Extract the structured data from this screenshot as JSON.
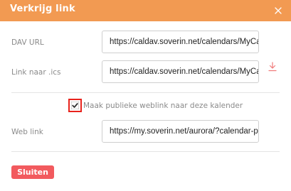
{
  "dialog": {
    "title": "Verkrijg link",
    "close_icon": "close-icon"
  },
  "dav": {
    "label": "DAV URL",
    "value": "https://caldav.soverin.net/calendars/MyCalendar"
  },
  "ics": {
    "label": "Link naar .ics",
    "value": "https://caldav.soverin.net/calendars/MyCalendar.ics",
    "download_icon": "download-icon"
  },
  "public": {
    "checkbox_checked": true,
    "label": "Maak publieke weblink naar deze kalender"
  },
  "weblink": {
    "label": "Web link",
    "value": "https://my.soverin.net/aurora/?calendar-pub="
  },
  "footer": {
    "close_label": "Sluiten"
  },
  "colors": {
    "header": "#f29a52",
    "button": "#f25a5e",
    "highlight": "#e8231c"
  }
}
